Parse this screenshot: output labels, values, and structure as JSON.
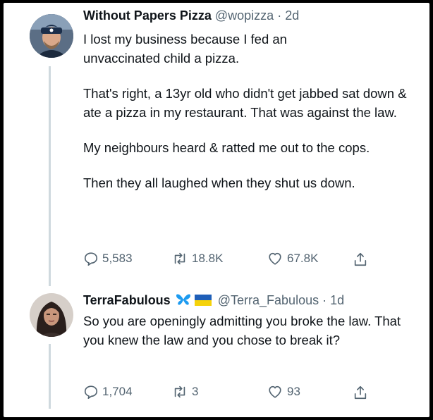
{
  "tweets": [
    {
      "display_name": "Without Papers Pizza",
      "handle": "@wopizza",
      "separator": "·",
      "time": "2d",
      "paragraphs": [
        "I lost my business because I fed an unvaccinated child a pizza.",
        "That's right, a 13yr old who didn't get jabbed sat down & ate a pizza in my restaurant. That was against the law.",
        "My neighbours heard & ratted me out to the cops.",
        "Then they all laughed when they shut us down."
      ],
      "replies": "5,583",
      "retweets": "18.8K",
      "likes": "67.8K"
    },
    {
      "display_name": "TerraFabulous",
      "name_emojis": [
        "butterfly-emoji",
        "ukraine-flag-emoji"
      ],
      "handle": "@Terra_Fabulous",
      "separator": "·",
      "time": "1d",
      "paragraphs": [
        "So you are openingly admitting you broke the law. That you knew the law and you chose to break it?"
      ],
      "replies": "1,704",
      "retweets": "3",
      "likes": "93"
    }
  ],
  "colors": {
    "text": "#0f1419",
    "secondary": "#536471",
    "thread_line": "#cfd9de",
    "butterfly": "#1d9bf0",
    "flag_blue": "#1f5fb8",
    "flag_yellow": "#f5d20a"
  }
}
